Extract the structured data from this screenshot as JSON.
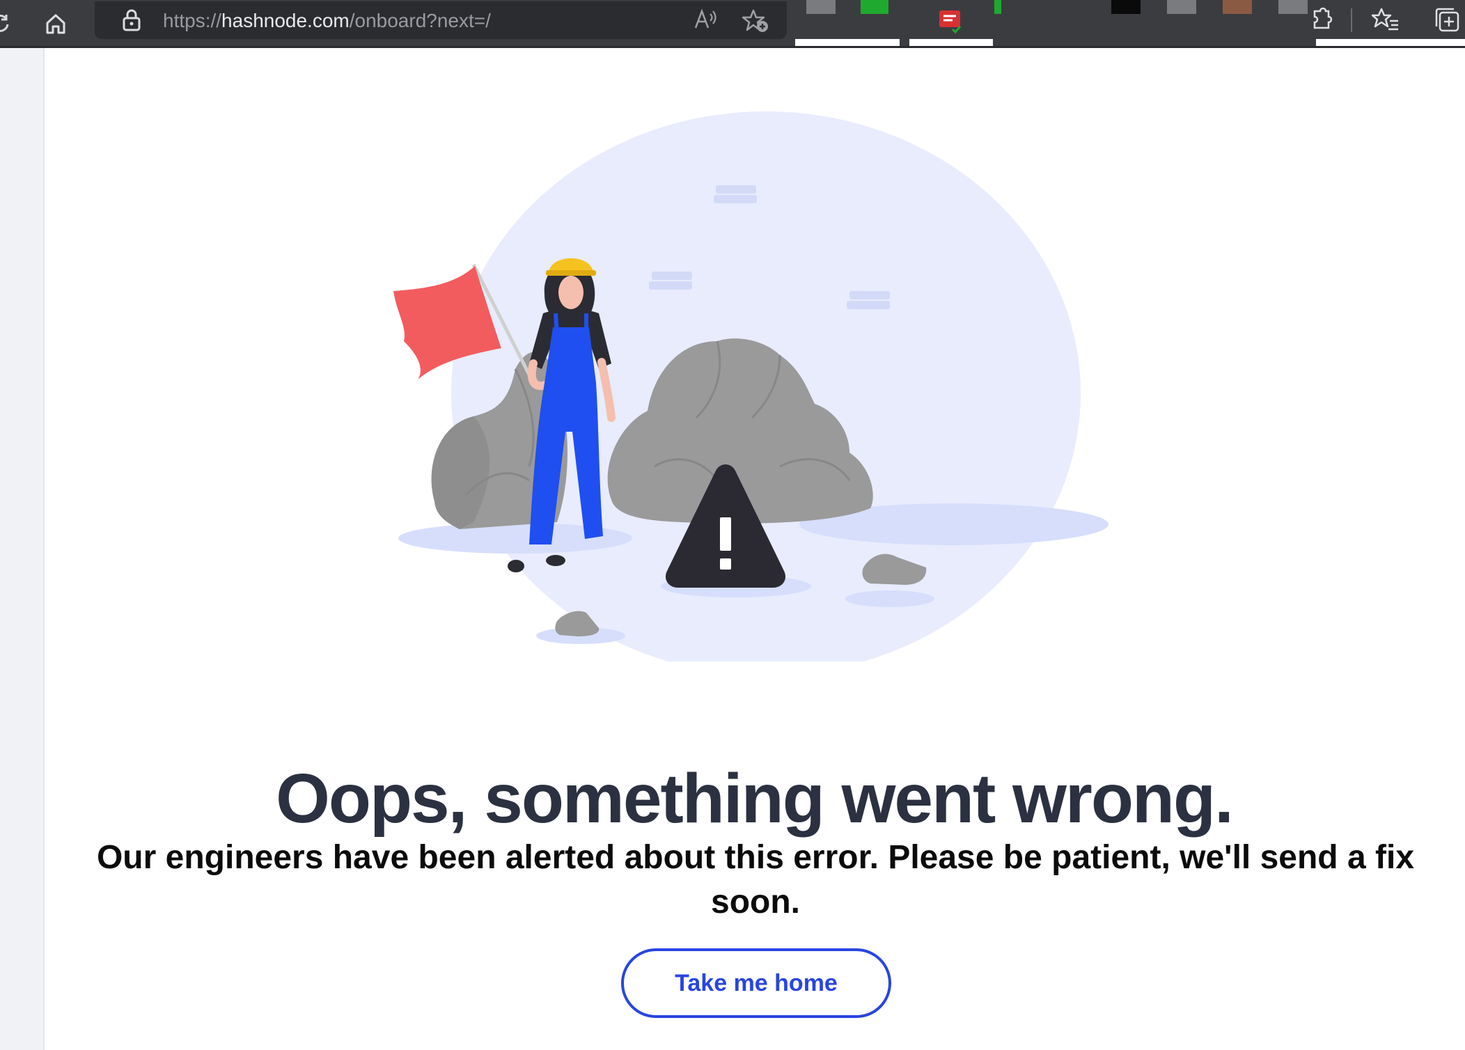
{
  "browser": {
    "url_prefix": "https://",
    "url_host": "hashnode.com",
    "url_path": "/onboard?next=/",
    "extension_colors": [
      "#7a7b7f",
      "#1faa2f",
      "#1faa2f",
      "#d93030",
      "#0a0a0a",
      "#7a7b7f",
      "#8a5a42",
      "#7a7b7f"
    ]
  },
  "error_page": {
    "headline": "Oops, something went wrong.",
    "message": "Our engineers have been alerted about this error. Please be patient, we'll send a fix soon.",
    "home_button_label": "Take me home"
  },
  "colors": {
    "accent": "#2845e0",
    "headline": "#2b3140",
    "flag": "#f25c5f",
    "overalls": "#1f4ff0",
    "helmet": "#f5c320",
    "rock": "#9a9a9a",
    "backdrop": "#e8ecfd"
  },
  "icons": [
    "reload-icon",
    "home-icon",
    "lock-icon",
    "read-aloud-icon",
    "add-favorite-icon",
    "extensions-icon",
    "favorites-icon",
    "collections-icon",
    "warning-icon"
  ]
}
